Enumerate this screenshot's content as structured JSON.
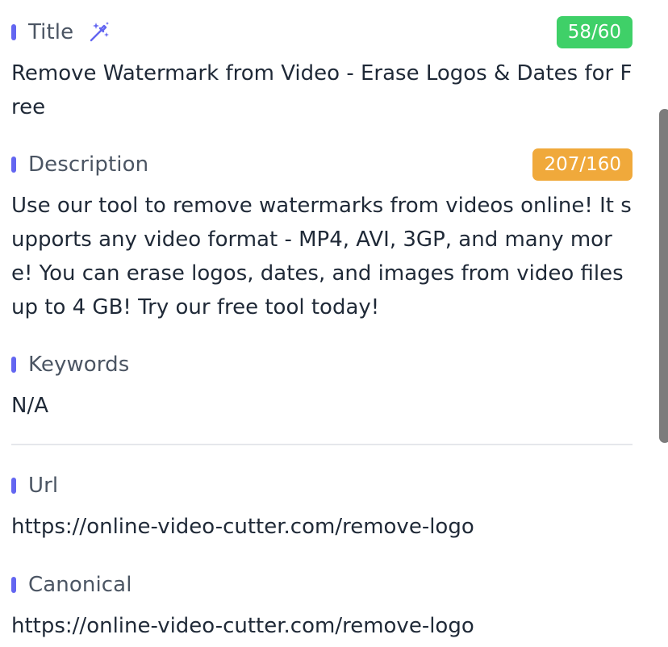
{
  "title_section": {
    "label": "Title",
    "badge": "58/60",
    "value": "Remove Watermark from Video - Erase Logos & Dates for Free",
    "badge_color": "#3fd068",
    "icon": "magic-wand-icon"
  },
  "description_section": {
    "label": "Description",
    "badge": "207/160",
    "value": "Use our tool to remove watermarks from videos online! It supports any video format - MP4, AVI, 3GP, and many more! You can erase logos, dates, and images from video files up to 4 GB! Try our free tool today!",
    "badge_color": "#f0a93b"
  },
  "keywords_section": {
    "label": "Keywords",
    "value": "N/A"
  },
  "url_section": {
    "label": "Url",
    "value": "https://online-video-cutter.com/remove-logo"
  },
  "canonical_section": {
    "label": "Canonical",
    "value": "https://online-video-cutter.com/remove-logo"
  },
  "accent_color": "#6366f1"
}
